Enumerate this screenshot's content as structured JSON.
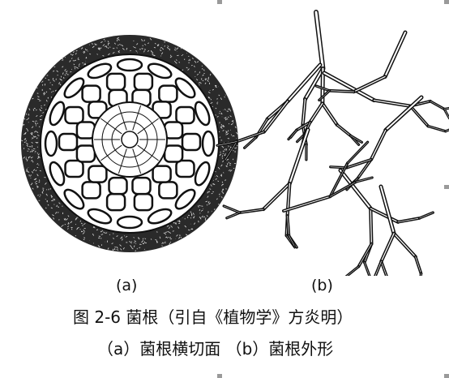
{
  "figure": {
    "label_a": "(a)",
    "label_b": "(b)",
    "caption_title": "图 2-6  菌根（引自《植物学》方炎明）",
    "caption_subtitle": "（a）菌根横切面   （b）菌根外形"
  }
}
